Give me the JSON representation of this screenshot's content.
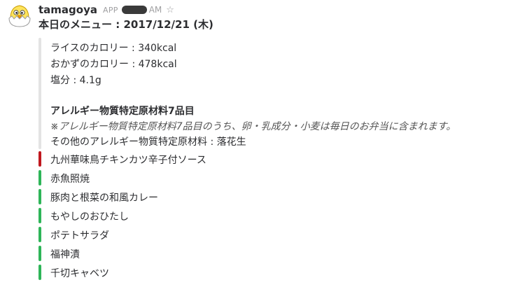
{
  "message": {
    "sender": "tamagoya",
    "app_badge": "APP",
    "time_suffix": "AM",
    "avatar_icon": "chick-egg-icon",
    "title": "本日のメニュー : 2017/12/21 (木)"
  },
  "quote": {
    "bar_color": "#e3e3e3",
    "lines": [
      "ライスのカロリー : 340kcal",
      "おかずのカロリー : 478kcal",
      "塩分 : 4.1g",
      "アレルギー物質特定原材料7品目",
      "※アレルギー物質特定原材料7品目のうち、卵・乳成分・小麦は毎日のお弁当に含まれます。",
      "その他のアレルギー物質特定原材料 : 落花生"
    ]
  },
  "items": [
    {
      "label": "九州華味鳥チキンカツ辛子付ソース",
      "color": "#c0181f"
    },
    {
      "label": "赤魚照焼",
      "color": "#2eb558"
    },
    {
      "label": "豚肉と根菜の和風カレー",
      "color": "#2eb558"
    },
    {
      "label": "もやしのおひたし",
      "color": "#2eb558"
    },
    {
      "label": "ポテトサラダ",
      "color": "#2eb558"
    },
    {
      "label": "福神漬",
      "color": "#2eb558"
    },
    {
      "label": "千切キャベツ",
      "color": "#2eb558"
    }
  ]
}
